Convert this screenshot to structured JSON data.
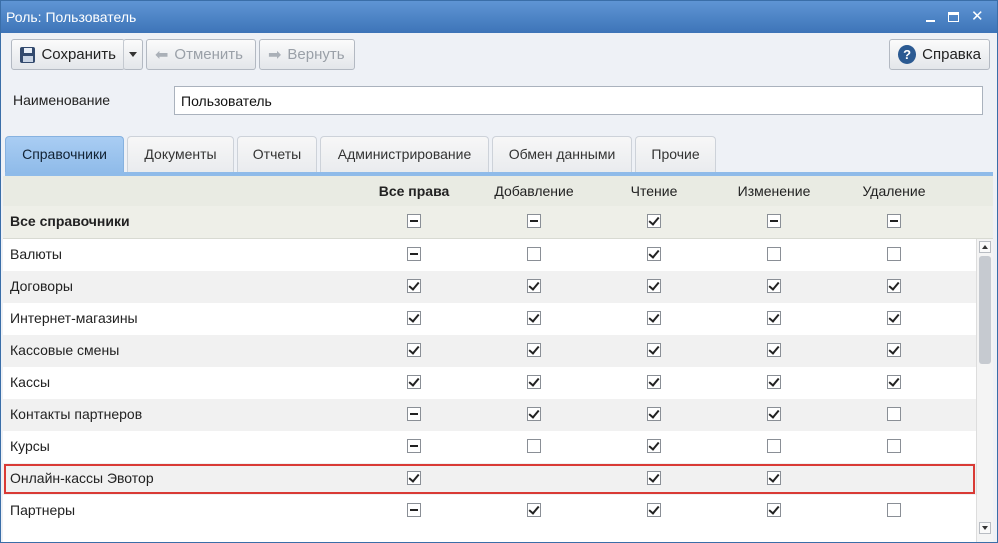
{
  "window": {
    "title": "Роль: Пользователь"
  },
  "toolbar": {
    "save_label": "Сохранить",
    "undo_label": "Отменить",
    "redo_label": "Вернуть",
    "help_label": "Справка"
  },
  "form": {
    "name_label": "Наименование",
    "name_value": "Пользователь"
  },
  "tabs": [
    {
      "label": "Справочники",
      "active": true
    },
    {
      "label": "Документы"
    },
    {
      "label": "Отчеты"
    },
    {
      "label": "Администрирование"
    },
    {
      "label": "Обмен данными"
    },
    {
      "label": "Прочие"
    }
  ],
  "grid": {
    "columns": [
      "Все права",
      "Добавление",
      "Чтение",
      "Изменение",
      "Удаление"
    ],
    "all_row": {
      "label": "Все справочники",
      "states": [
        "partial",
        "partial",
        "check",
        "partial",
        "partial"
      ]
    },
    "rows": [
      {
        "label": "Валюты",
        "states": [
          "partial",
          "empty",
          "check",
          "empty",
          "empty"
        ]
      },
      {
        "label": "Договоры",
        "states": [
          "check",
          "check",
          "check",
          "check",
          "check"
        ]
      },
      {
        "label": "Интернет-магазины",
        "states": [
          "check",
          "check",
          "check",
          "check",
          "check"
        ]
      },
      {
        "label": "Кассовые смены",
        "states": [
          "check",
          "check",
          "check",
          "check",
          "check"
        ]
      },
      {
        "label": "Кассы",
        "states": [
          "check",
          "check",
          "check",
          "check",
          "check"
        ]
      },
      {
        "label": "Контакты партнеров",
        "states": [
          "partial",
          "check",
          "check",
          "check",
          "empty"
        ]
      },
      {
        "label": "Курсы",
        "states": [
          "partial",
          "empty",
          "check",
          "empty",
          "empty"
        ]
      },
      {
        "label": "Онлайн-кассы Эвотор",
        "states": [
          "check",
          "none",
          "check",
          "check",
          "none"
        ],
        "highlighted": true
      },
      {
        "label": "Партнеры",
        "states": [
          "partial",
          "check",
          "check",
          "check",
          "empty"
        ]
      }
    ]
  },
  "colors": {
    "title_bar": "#3d74b8",
    "active_tab": "#8fbbe9",
    "highlight": "#d93a35"
  }
}
